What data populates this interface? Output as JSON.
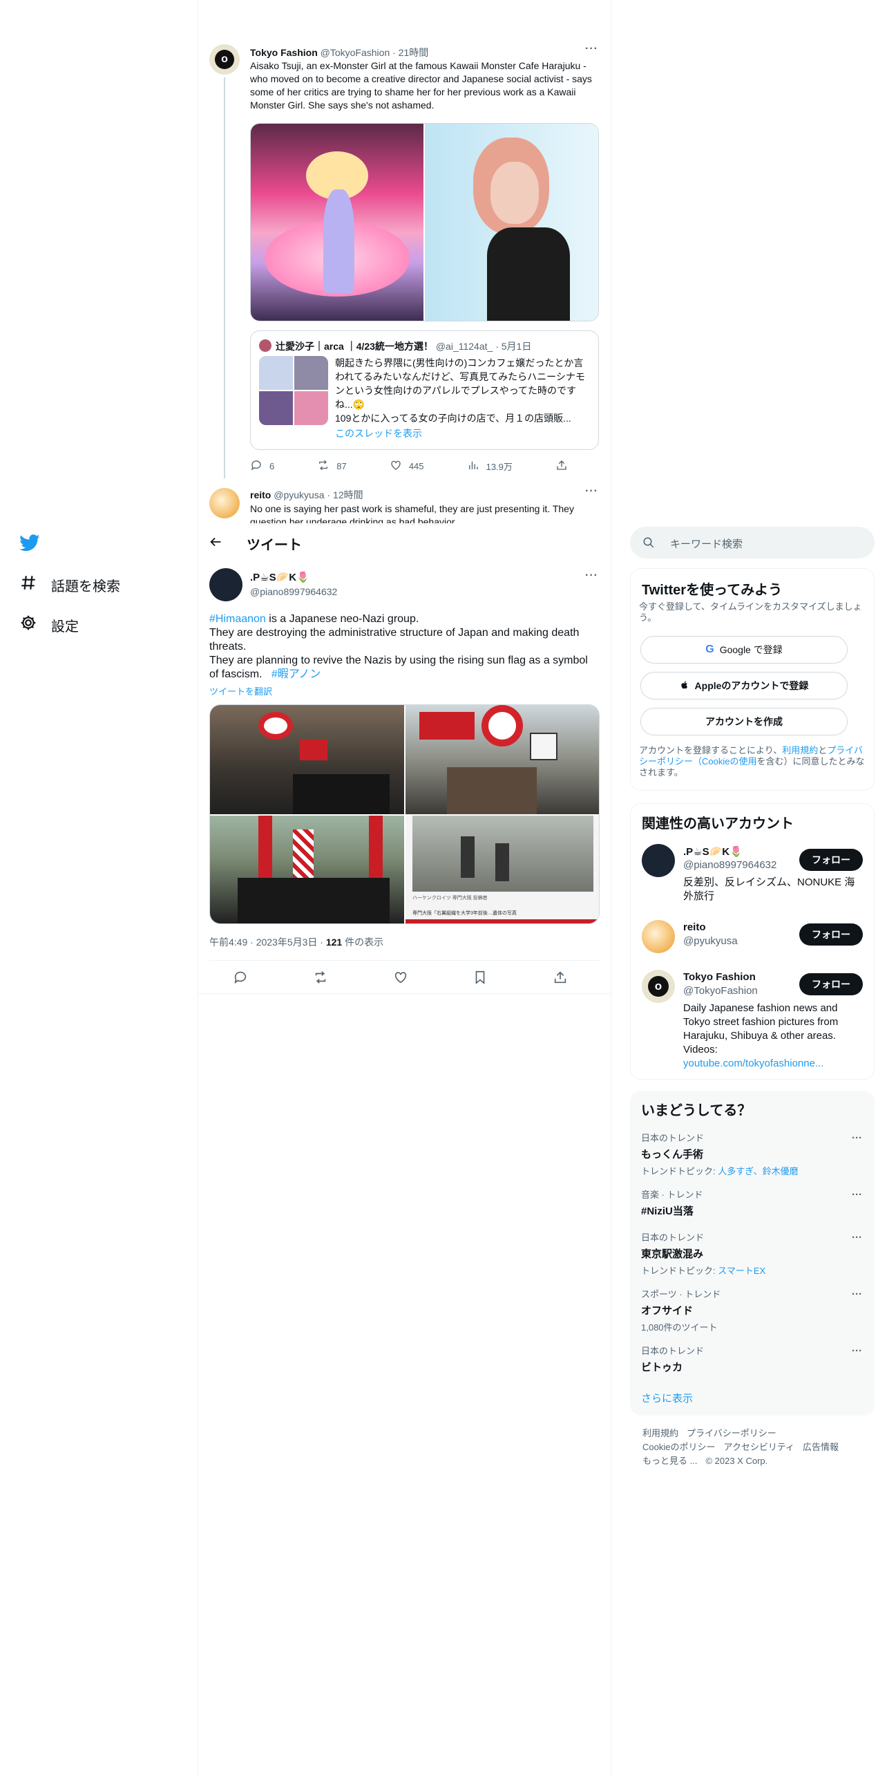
{
  "nav": {
    "items": [
      {
        "label": "話題を検索"
      },
      {
        "label": "設定"
      }
    ]
  },
  "timeline": {
    "tweet1": {
      "name": "Tokyo Fashion",
      "handle": "@TokyoFashion",
      "time": "· 21時間",
      "text": "Aisako Tsuji, an ex-Monster Girl at the famous Kawaii Monster Cafe Harajuku - who moved on to become a creative director and Japanese social activist - says some of her critics are trying to shame her for her previous work as a Kawaii Monster Girl. She says she's not ashamed.",
      "quote": {
        "name": "辻愛沙子｜arca ｜4/23統一地方選！",
        "handle": "@ai_1124at_",
        "time": "· 5月1日",
        "text": "朝起きたら界隈に(男性向けの)コンカフェ嬢だったとか言われてるみたいなんだけど、写真見てみたらハニーシナモンという女性向けのアパレルでプレスやってた時のですね...🙄\n109とかに入ってる女の子向けの店で、月１の店頭販...",
        "thread_link": "このスレッドを表示"
      },
      "actions": {
        "reply": "6",
        "retweet": "87",
        "like": "445",
        "views": "13.9万"
      }
    },
    "tweet2": {
      "name": "reito",
      "handle": "@pyukyusa",
      "time": "· 12時間",
      "text": "No one is saying her past work is shameful, they are just presenting it. They question her underage drinking as bad behavior"
    }
  },
  "header": {
    "title": "ツイート"
  },
  "main_tweet": {
    "name": ".P☕S🥟K🌷",
    "handle": "@piano8997964632",
    "hashtag1": "#Himaanon",
    "text1": " is a Japanese neo-Nazi group.",
    "text2": "They are destroying the administrative structure of Japan and making death threats.",
    "text3": "They are planning to revive the Nazis by using the rising sun flag as a symbol of fascism.",
    "hashtag2": "#暇アノン",
    "translate": "ツイートを翻訳",
    "time": "午前4:49 · 2023年5月3日 · ",
    "views_count": "121",
    "views_label": " 件の表示",
    "image4_caption": "ハーケンクロイツ 専門大阪 投稿者",
    "image4_caption2": "専門大阪「右翼組織を大学3年前後…遺体の写真"
  },
  "search": {
    "placeholder": "キーワード検索"
  },
  "signup": {
    "title": "Twitterを使ってみよう",
    "desc": "今すぐ登録して、タイムラインをカスタマイズしましょう。",
    "google": "Google で登録",
    "apple": "Appleのアカウントで登録",
    "create": "アカウントを作成",
    "terms_pre": "アカウントを登録することにより、",
    "terms_link1": "利用規約",
    "terms_mid": "と",
    "terms_link2": "プライバシーポリシー（Cookieの使用",
    "terms_post": "を含む）に同意したとみなされます。"
  },
  "related": {
    "title": "関連性の高いアカウント",
    "follow": "フォロー",
    "accounts": [
      {
        "name": ".P☕S🥟K🌷",
        "handle": "@piano8997964632",
        "bio": "反差別、反レイシズム、NONUKE 海外旅行"
      },
      {
        "name": "reito",
        "handle": "@pyukyusa",
        "bio": ""
      },
      {
        "name": "Tokyo Fashion",
        "handle": "@TokyoFashion",
        "bio": "Daily Japanese fashion news and Tokyo street fashion pictures from Harajuku, Shibuya & other areas. Videos:",
        "link": "youtube.com/tokyofashionne..."
      }
    ]
  },
  "trends": {
    "title": "いまどうしてる？",
    "items": [
      {
        "category": "日本のトレンド",
        "name": "もっくん手術",
        "sub_pre": "トレンドトピック: ",
        "sub_link": "人多すぎ、鈴木優磨"
      },
      {
        "category": "音楽 · トレンド",
        "name": "#NiziU当落",
        "sub_pre": "",
        "sub_link": ""
      },
      {
        "category": "日本のトレンド",
        "name": "東京駅激混み",
        "sub_pre": "トレンドトピック: ",
        "sub_link": "スマートEX"
      },
      {
        "category": "スポーツ · トレンド",
        "name": "オフサイド",
        "sub_pre": "1,080件のツイート",
        "sub_link": ""
      },
      {
        "category": "日本のトレンド",
        "name": "ビトゥカ",
        "sub_pre": "",
        "sub_link": ""
      }
    ],
    "more": "さらに表示"
  },
  "footer": {
    "links1": [
      "利用規約",
      "プライバシーポリシー"
    ],
    "links2": [
      "Cookieのポリシー",
      "アクセシビリティ",
      "広告情報"
    ],
    "more": "もっと見る ...",
    "copyright": "© 2023 X Corp."
  },
  "colors": {
    "accent": "#1d9bf0",
    "text": "#0f1419",
    "muted": "#536471",
    "card": "#f7f9f9"
  }
}
